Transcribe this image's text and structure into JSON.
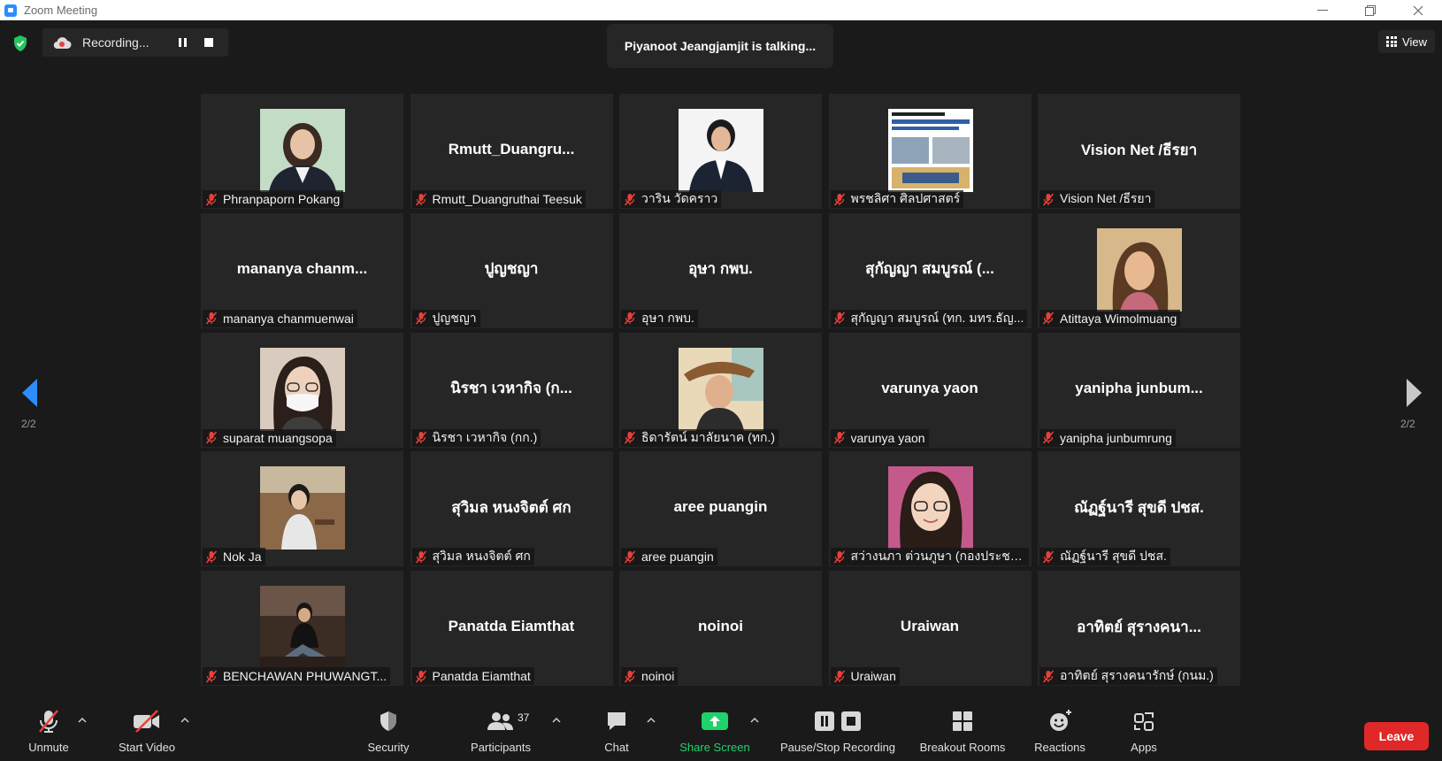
{
  "window": {
    "title": "Zoom Meeting"
  },
  "recording": {
    "label": "Recording..."
  },
  "talking_banner": "Piyanoot Jeangjamjit is talking...",
  "view_button": "View",
  "pager": {
    "left": "2/2",
    "right": "2/2"
  },
  "tiles": [
    {
      "big": "",
      "name": "Phranpaporn Pokang",
      "photo": "woman-green-bg"
    },
    {
      "big": "Rmutt_Duangru...",
      "name": "Rmutt_Duangruthai Teesuk"
    },
    {
      "big": "",
      "name": "วาริน วัดคราว",
      "photo": "woman-suit-white-bg"
    },
    {
      "big": "",
      "name": "พรชลิศา ศิลปศาสตร์",
      "photo": "document-poster"
    },
    {
      "big": "Vision Net /ธีรยา",
      "name": "Vision Net /ธีรยา"
    },
    {
      "big": "mananya  chanm...",
      "name": "mananya chanmuenwai"
    },
    {
      "big": "ปูญชญา",
      "name": "ปูญชญา"
    },
    {
      "big": "อุษา กพบ.",
      "name": "อุษา กพบ."
    },
    {
      "big": "สุกัญญา สมบูรณ์ (...",
      "name": "สุกัญญา สมบูรณ์ (ทก. มทร.ธัญ..."
    },
    {
      "big": "",
      "name": "Atittaya Wimolmuang",
      "photo": "woman-selfie"
    },
    {
      "big": "",
      "name": "suparat muangsopa",
      "photo": "woman-mask"
    },
    {
      "big": "นิรชา  เวหากิจ (ก...",
      "name": "นิรชา  เวหากิจ (กก.)"
    },
    {
      "big": "",
      "name": "ธิดารัตน์ มาลัยนาค (ทก.)",
      "photo": "woman-hat"
    },
    {
      "big": "varunya  yaon",
      "name": "varunya  yaon"
    },
    {
      "big": "yanipha  junbum...",
      "name": "yanipha junbumrung"
    },
    {
      "big": "",
      "name": "Nok Ja",
      "photo": "woman-cafe"
    },
    {
      "big": "สุวิมล หนงจิตต์ ศก",
      "name": "สุวิมล หนงจิตต์ ศก"
    },
    {
      "big": "aree puangin",
      "name": "aree puangin"
    },
    {
      "big": "",
      "name": "สว่างนภา ต่วนภูษา (กองประชาสั...",
      "photo": "woman-glasses"
    },
    {
      "big": "ณัฏฐ์นารี สุขดี ปชส.",
      "name": "ณัฏฐ์นารี สุขดี ปชส."
    },
    {
      "big": "",
      "name": "BENCHAWAN PHUWANGT...",
      "photo": "woman-sitting"
    },
    {
      "big": "Panatda Eiamthat",
      "name": "Panatda Eiamthat"
    },
    {
      "big": "noinoi",
      "name": "noinoi"
    },
    {
      "big": "Uraiwan",
      "name": "Uraiwan"
    },
    {
      "big": "อาทิตย์ สุรางคนา...",
      "name": "อาทิตย์ สุรางคนารักษ์ (กนม.)"
    }
  ],
  "toolbar": {
    "unmute": "Unmute",
    "start_video": "Start Video",
    "security": "Security",
    "participants": "Participants",
    "participants_count": "37",
    "chat": "Chat",
    "share_screen": "Share Screen",
    "pause_stop": "Pause/Stop Recording",
    "breakout": "Breakout Rooms",
    "reactions": "Reactions",
    "apps": "Apps",
    "leave": "Leave"
  },
  "colors": {
    "leave": "#e02828",
    "share_green": "#20d26b",
    "nav_arrow": "#2d8cff",
    "mic_off": "#e8403b"
  }
}
